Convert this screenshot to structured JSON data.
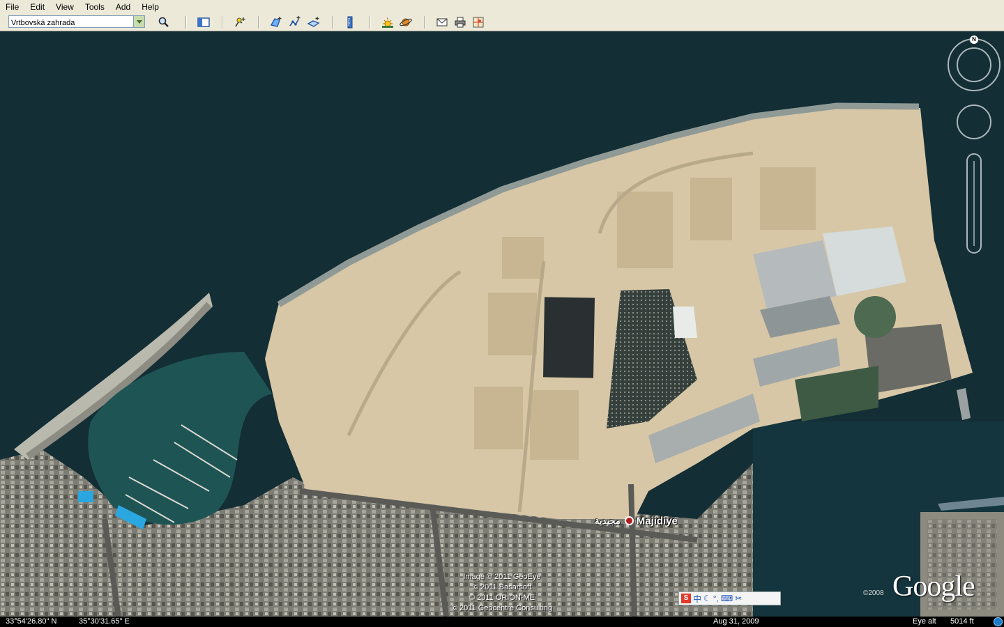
{
  "menu": [
    "File",
    "Edit",
    "View",
    "Tools",
    "Add",
    "Help"
  ],
  "search": {
    "value": "Vrtbovská zahrada"
  },
  "toolbar_icons": [
    "search-icon",
    "sidebar-toggle-icon",
    "placemark-icon",
    "polygon-icon",
    "path-icon",
    "image-overlay-icon",
    "ruler-icon",
    "sun-icon",
    "planet-icon",
    "email-icon",
    "print-icon",
    "view-in-maps-icon"
  ],
  "map": {
    "place_label_ar": "مجيدية",
    "place_label_en": "Majidiye",
    "credits": [
      "Image © 2011 GeoEye",
      "© 2011 Basarsoft",
      "© 2011 ORION-ME",
      "© 2011 Geocentre Consulting"
    ],
    "logo": "Google",
    "logo_year": "©2008",
    "compass_north": "N"
  },
  "ime": {
    "chars": [
      "中"
    ]
  },
  "status": {
    "lat": "33°54'26.80\" N",
    "lon": "35°30'31.65\" E",
    "date": "Aug 31, 2009",
    "eye_alt_label": "Eye alt",
    "eye_alt_value": "5014 ft"
  }
}
